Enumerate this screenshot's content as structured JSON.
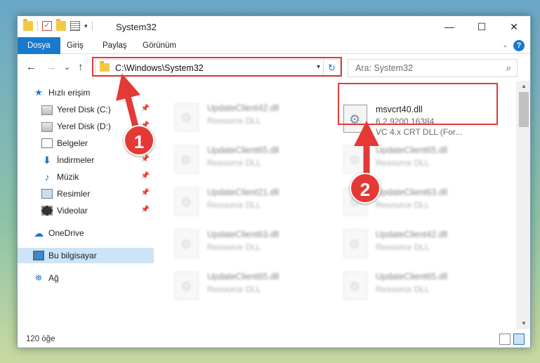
{
  "window": {
    "title": "System32",
    "controls": {
      "minimize": "—",
      "maximize": "☐",
      "close": "✕"
    }
  },
  "ribbon": {
    "tabs": [
      {
        "label": "Dosya",
        "active": true
      },
      {
        "label": "Giriş"
      },
      {
        "label": "Paylaş"
      },
      {
        "label": "Görünüm"
      }
    ],
    "help": "?"
  },
  "navigation": {
    "back": "←",
    "forward": "→",
    "recent": "⌄",
    "up": "↑",
    "address": "C:\\Windows\\System32",
    "refresh": "↻",
    "search_placeholder": "Ara: System32"
  },
  "sidebar": {
    "items": [
      {
        "label": "Hızlı erişim",
        "icon": "star-icon"
      },
      {
        "label": "Yerel Disk (C:)",
        "icon": "disk-icon",
        "pinned": true
      },
      {
        "label": "Yerel Disk (D:)",
        "icon": "disk-icon",
        "pinned": true
      },
      {
        "label": "Belgeler",
        "icon": "documents-icon",
        "pinned": true
      },
      {
        "label": "İndirmeler",
        "icon": "download-icon",
        "pinned": true
      },
      {
        "label": "Müzik",
        "icon": "music-icon",
        "pinned": true
      },
      {
        "label": "Resimler",
        "icon": "pictures-icon",
        "pinned": true
      },
      {
        "label": "Videolar",
        "icon": "video-icon",
        "pinned": true
      },
      {
        "label": "OneDrive",
        "icon": "cloud-icon"
      },
      {
        "label": "Bu bilgisayar",
        "icon": "computer-icon",
        "selected": true
      },
      {
        "label": "Ağ",
        "icon": "network-icon"
      }
    ]
  },
  "files": {
    "left_column": [
      {
        "name": "UpdateClient42.dll",
        "type": "Resource DLL"
      },
      {
        "name": "UpdateClient65.dll",
        "type": "Resource DLL"
      },
      {
        "name": "UpdateClient21.dll",
        "type": "Resource DLL"
      },
      {
        "name": "UpdateClient63.dll",
        "type": "Resource DLL"
      },
      {
        "name": "UpdateClient65.dll",
        "type": "Resource DLL"
      }
    ],
    "highlighted": {
      "name": "msvcrt40.dll",
      "version": "6.2.9200.16384",
      "description": "VC 4.x CRT DLL (For..."
    },
    "right_column": [
      {
        "name": "UpdateClient65.dll",
        "type": "Resource DLL"
      },
      {
        "name": "UpdateClient63.dll",
        "type": "Resource DLL"
      },
      {
        "name": "UpdateClient42.dll",
        "type": "Resource DLL"
      },
      {
        "name": "UpdateClient65.dll",
        "type": "Resource DLL"
      }
    ]
  },
  "status": {
    "item_count": "120 öğe"
  },
  "annotations": {
    "step1": "1",
    "step2": "2",
    "color": "#e53935"
  }
}
